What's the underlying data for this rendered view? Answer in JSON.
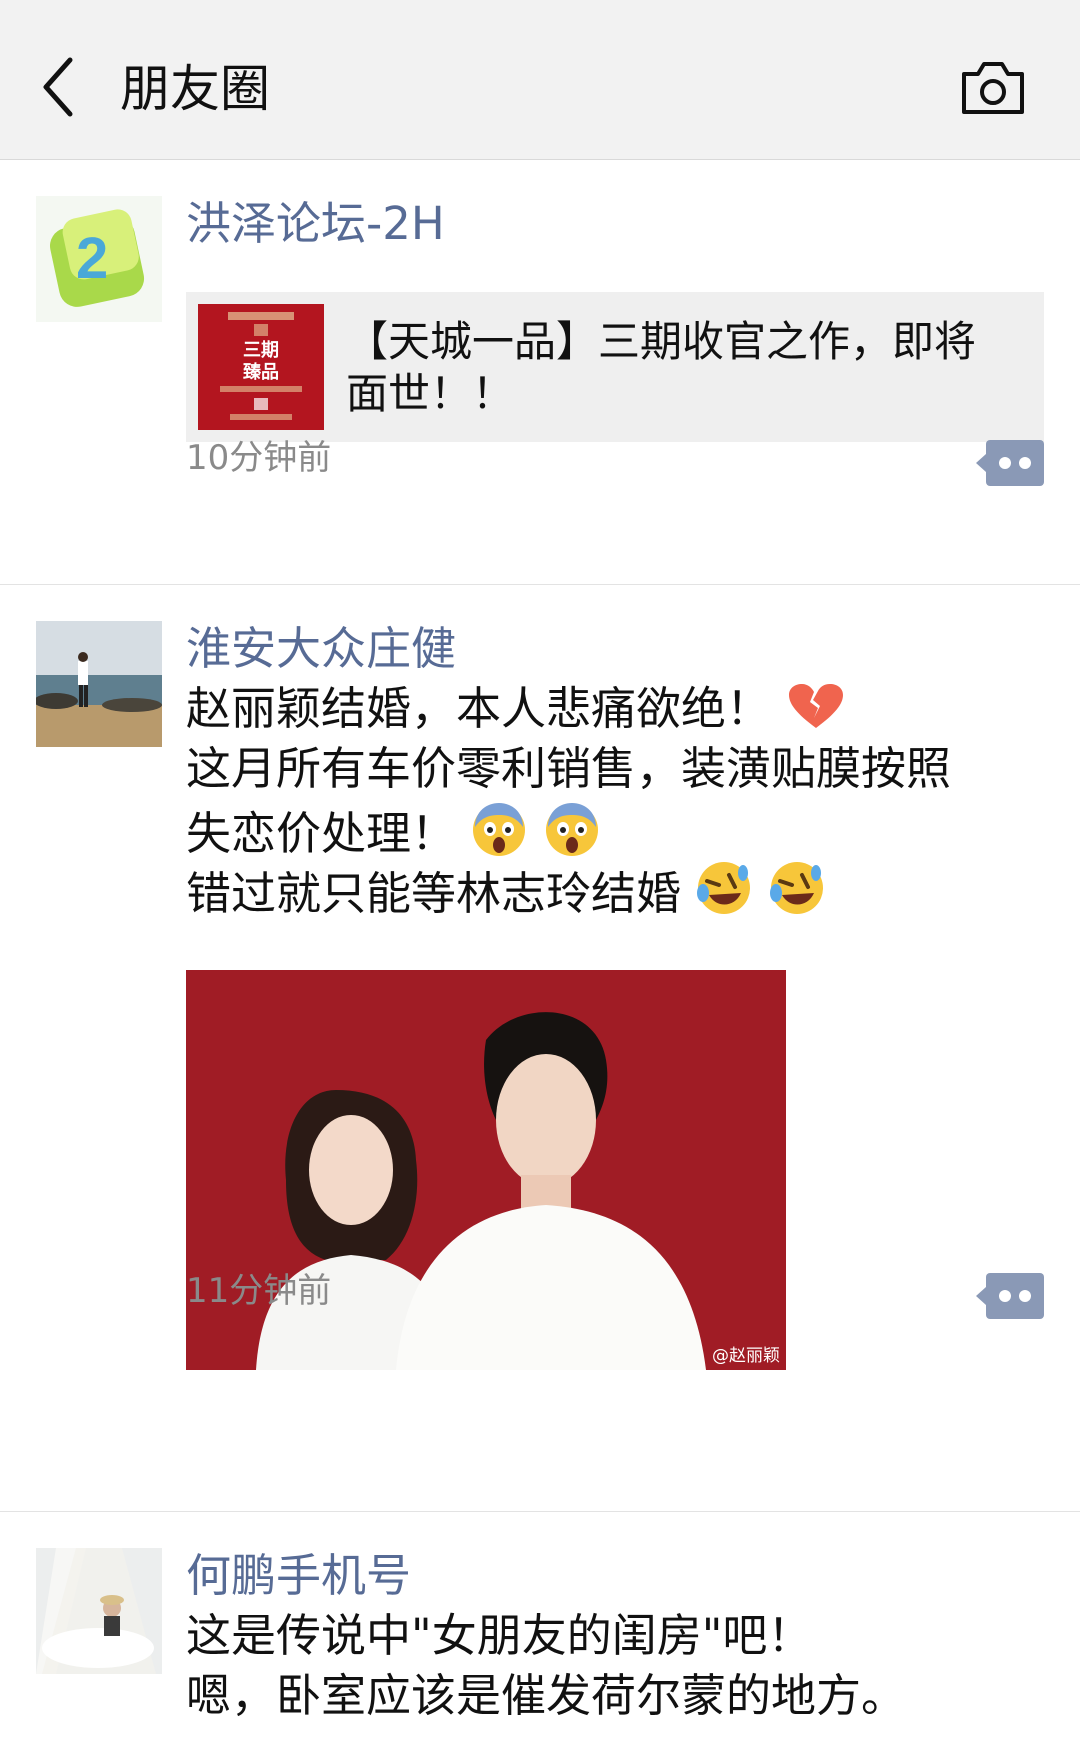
{
  "header": {
    "title": "朋友圈"
  },
  "posts": [
    {
      "name": "洪泽论坛-2H",
      "share": {
        "title": "【天城一品】三期收官之作，即将面世！！",
        "thumb_text": "三期臻品"
      },
      "time": "10分钟前"
    },
    {
      "name": "淮安大众庄健",
      "lines": [
        "赵丽颖结婚，本人悲痛欲绝！",
        "这月所有车价零利销售，装潢贴膜按照",
        "失恋价处理！",
        "错过就只能等林志玲结婚"
      ],
      "photo_watermark": "@赵丽颖",
      "time": "11分钟前"
    },
    {
      "name": "何鹏手机号",
      "lines": [
        "这是传说中\"女朋友的闺房\"吧！",
        "嗯，卧室应该是催发荷尔蒙的地方。"
      ]
    }
  ],
  "colors": {
    "name": "#576b95",
    "header_bg": "#f2f2f2",
    "more_button": "#8a99b6"
  },
  "icons": {
    "back": "chevron-left-icon",
    "camera": "camera-icon",
    "more": "comment-more-icon",
    "broken_heart": "broken-heart-emoji",
    "scream": "scream-emoji",
    "cry_laugh": "rolling-laugh-emoji"
  }
}
